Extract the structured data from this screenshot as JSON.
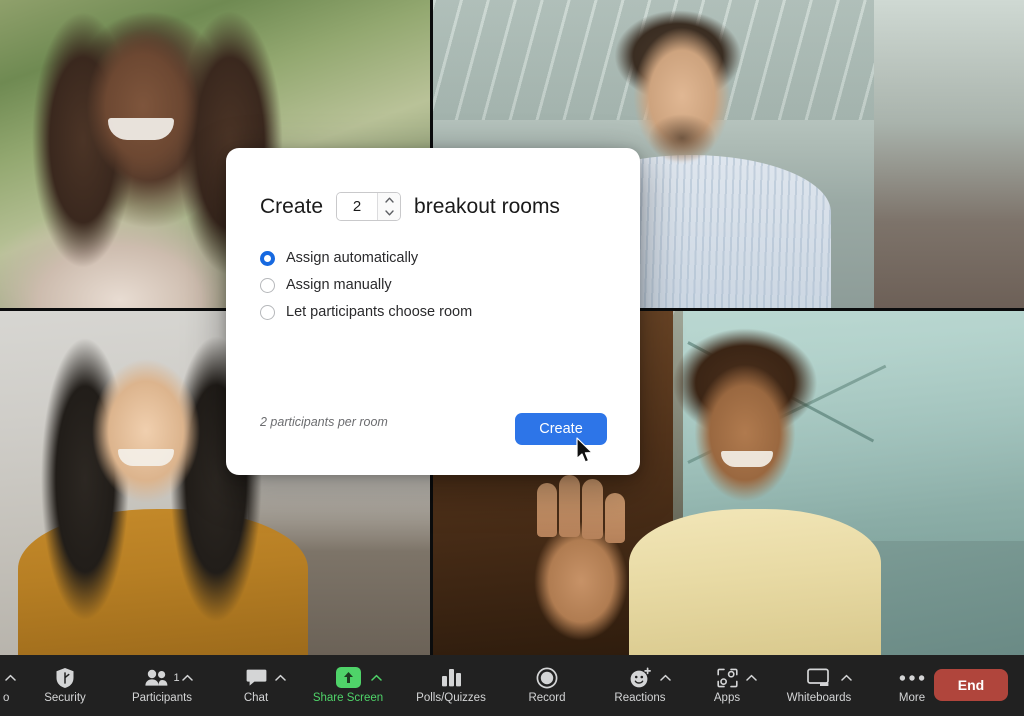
{
  "dialog": {
    "title_lead": "Create",
    "title_trail": "breakout rooms",
    "rooms_count": "2",
    "stepper_up_icon": "chevron-up-icon",
    "stepper_down_icon": "chevron-down-icon",
    "options": [
      {
        "label": "Assign automatically",
        "selected": true
      },
      {
        "label": "Assign manually",
        "selected": false
      },
      {
        "label": "Let participants choose room",
        "selected": false
      }
    ],
    "participants_note": "2 participants per room",
    "create_label": "Create",
    "accent_color": "#2d75e8"
  },
  "toolbar": {
    "background": "#212121",
    "active_color": "#4fd369",
    "items": [
      {
        "label": "Security",
        "icon": "shield-icon",
        "caret": false,
        "count": null,
        "active": false
      },
      {
        "label": "Participants",
        "icon": "people-icon",
        "caret": true,
        "count": "1",
        "active": false
      },
      {
        "label": "Chat",
        "icon": "chat-bubble-icon",
        "caret": true,
        "count": null,
        "active": false
      },
      {
        "label": "Share Screen",
        "icon": "share-screen-icon",
        "caret": true,
        "count": null,
        "active": true
      },
      {
        "label": "Polls/Quizzes",
        "icon": "bar-chart-icon",
        "caret": false,
        "count": null,
        "active": false
      },
      {
        "label": "Record",
        "icon": "record-circle-icon",
        "caret": false,
        "count": null,
        "active": false
      },
      {
        "label": "Reactions",
        "icon": "smiley-plus-icon",
        "caret": true,
        "count": null,
        "active": false
      },
      {
        "label": "Apps",
        "icon": "apps-bracket-icon",
        "caret": true,
        "count": null,
        "active": false
      },
      {
        "label": "Whiteboards",
        "icon": "whiteboard-icon",
        "caret": true,
        "count": null,
        "active": false
      },
      {
        "label": "More",
        "icon": "ellipsis-icon",
        "caret": false,
        "count": null,
        "active": false
      }
    ],
    "end_label": "End",
    "end_color": "#b0453c"
  },
  "video_grid": {
    "active_speaker_color": "#35d07f",
    "tiles": [
      {
        "position": "top-left",
        "active_speaker": false
      },
      {
        "position": "top-right",
        "active_speaker": false
      },
      {
        "position": "bottom-left",
        "active_speaker": false
      },
      {
        "position": "bottom-right",
        "active_speaker": true
      }
    ]
  },
  "cursor": {
    "type": "arrow-pointer"
  }
}
